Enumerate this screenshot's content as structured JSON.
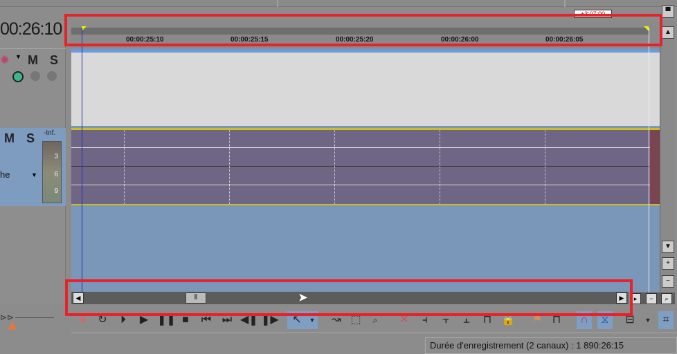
{
  "timecode": "00:26:10",
  "ruler": {
    "ticks": [
      "00:00:25:10",
      "00:00:25:15",
      "00:00:25:20",
      "00:00:26:00",
      "00:00:26:05"
    ],
    "marker_label": "+3:07:00"
  },
  "track_video": {
    "mute": "M",
    "solo": "S"
  },
  "track_audio": {
    "mute": "M",
    "solo": "S",
    "name_partial": "he",
    "meter": {
      "top": "-Inf.",
      "marks": [
        "3",
        "6",
        "9"
      ]
    }
  },
  "status": {
    "recording_duration": "Durée d'enregistrement (2 canaux) : 1 890:26:15"
  },
  "colors": {
    "annotation": "#e8222a",
    "audio_track": "#6f6585",
    "video_track": "#d9d9d9",
    "selected_tool": "#7f9ec4"
  }
}
